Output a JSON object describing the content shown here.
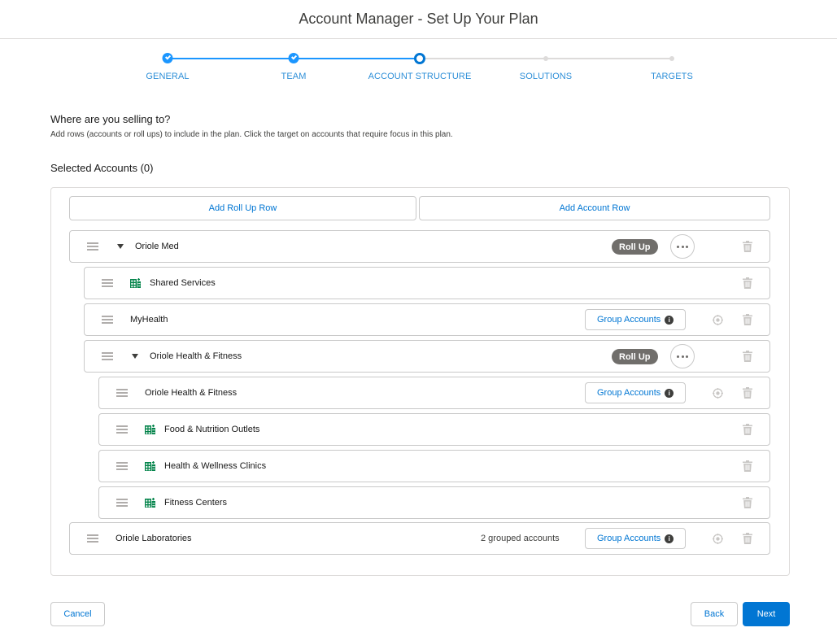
{
  "header": {
    "title": "Account Manager - Set Up Your Plan"
  },
  "progress": {
    "steps": [
      {
        "label": "GENERAL",
        "state": "complete"
      },
      {
        "label": "TEAM",
        "state": "complete"
      },
      {
        "label": "ACCOUNT STRUCTURE",
        "state": "active"
      },
      {
        "label": "SOLUTIONS",
        "state": "pending"
      },
      {
        "label": "TARGETS",
        "state": "pending"
      }
    ]
  },
  "section": {
    "title": "Where are you selling to?",
    "description": "Add rows (accounts or roll ups) to include in the plan. Click the target on accounts that require focus in this plan.",
    "selected_title": "Selected Accounts (0)"
  },
  "actions": {
    "add_roll_up": "Add Roll Up Row",
    "add_account": "Add Account Row"
  },
  "rows": [
    {
      "label": "Oriole Med",
      "type": "rollup",
      "badge": "Roll Up"
    },
    {
      "label": "Shared Services",
      "type": "account-group"
    },
    {
      "label": "MyHealth",
      "type": "account",
      "group_button": "Group Accounts"
    },
    {
      "label": "Oriole Health & Fitness",
      "type": "rollup",
      "badge": "Roll Up"
    },
    {
      "label": "Oriole Health & Fitness",
      "type": "account",
      "group_button": "Group Accounts"
    },
    {
      "label": "Food & Nutrition Outlets",
      "type": "account-group"
    },
    {
      "label": "Health & Wellness Clinics",
      "type": "account-group"
    },
    {
      "label": "Fitness Centers",
      "type": "account-group"
    },
    {
      "label": "Oriole Laboratories",
      "type": "account",
      "group_button": "Group Accounts",
      "grouped_count": "2 grouped accounts"
    }
  ],
  "footer": {
    "cancel": "Cancel",
    "back": "Back",
    "next": "Next"
  },
  "colors": {
    "brand": "#0176d3",
    "progress": "#1b96ff",
    "badge": "#706e6b",
    "grid_icon": "#04844b"
  }
}
